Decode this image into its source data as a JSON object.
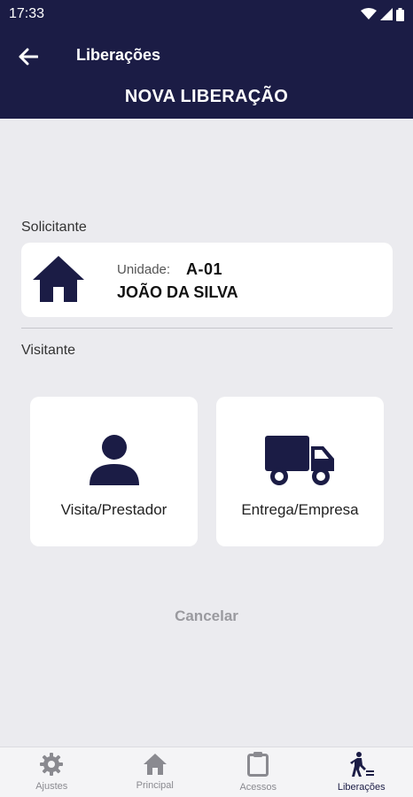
{
  "status_bar": {
    "time": "17:33",
    "icons": [
      "wifi-icon",
      "signal-icon",
      "battery-icon"
    ]
  },
  "header": {
    "title": "Liberações",
    "subtitle": "NOVA LIBERAÇÃO"
  },
  "requester": {
    "section_label": "Solicitante",
    "unit_label": "Unidade:",
    "unit_value": "A-01",
    "name": "JOÃO DA SILVA"
  },
  "visitor": {
    "section_label": "Visitante",
    "options": [
      {
        "label": "Visita/Prestador",
        "icon": "person-icon"
      },
      {
        "label": "Entrega/Empresa",
        "icon": "truck-icon"
      }
    ]
  },
  "cancel_label": "Cancelar",
  "bottom_nav": [
    {
      "label": "Ajustes",
      "icon": "gear-icon",
      "active": false
    },
    {
      "label": "Principal",
      "icon": "home-icon",
      "active": false
    },
    {
      "label": "Acessos",
      "icon": "clipboard-icon",
      "active": false
    },
    {
      "label": "Liberações",
      "icon": "walking-person-icon",
      "active": true
    }
  ],
  "colors": {
    "primary": "#1b1c45",
    "background": "#ebebef",
    "card": "#ffffff",
    "muted": "#9a9a9f"
  }
}
